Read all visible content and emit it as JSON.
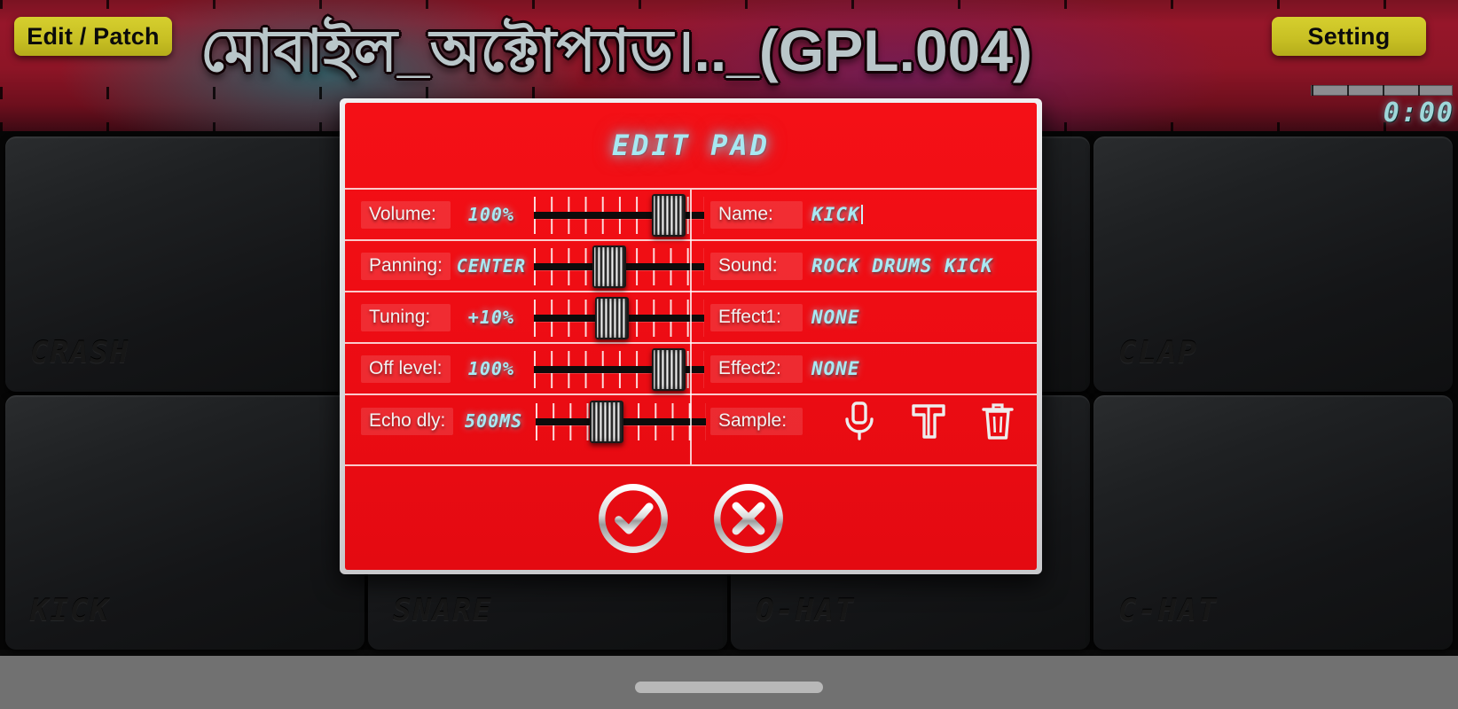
{
  "header": {
    "edit_patch_label": "Edit / Patch",
    "setting_label": "Setting",
    "title": "মোবাইল_অক্টোপ্যাড।.._(GPL.004)",
    "timecode": "0:00"
  },
  "pads": [
    {
      "label": "CRASH"
    },
    {
      "label": ""
    },
    {
      "label": ""
    },
    {
      "label": "CLAP"
    },
    {
      "label": "KICK"
    },
    {
      "label": "SNARE"
    },
    {
      "label": "O-HAT"
    },
    {
      "label": "C-HAT"
    }
  ],
  "dialog": {
    "title": "EDIT PAD",
    "left_rows": [
      {
        "label": "Volume:",
        "value": "100%",
        "thumb_pct": 86
      },
      {
        "label": "Panning:",
        "value": "CENTER",
        "thumb_pct": 48
      },
      {
        "label": "Tuning:",
        "value": "+10%",
        "thumb_pct": 50
      },
      {
        "label": "Off level:",
        "value": "100%",
        "thumb_pct": 86
      },
      {
        "label": "Echo dly:",
        "value": "500MS",
        "thumb_pct": 46
      }
    ],
    "right_rows": [
      {
        "label": "Name:",
        "value": "KICK",
        "editing": true
      },
      {
        "label": "Sound:",
        "value": "ROCK DRUMS KICK",
        "editing": false
      },
      {
        "label": "Effect1:",
        "value": "NONE",
        "editing": false
      },
      {
        "label": "Effect2:",
        "value": "NONE",
        "editing": false
      },
      {
        "label": "Sample:",
        "value": "",
        "editing": false
      }
    ],
    "sample_icons": [
      {
        "name": "microphone-icon"
      },
      {
        "name": "scissors-trim-icon"
      },
      {
        "name": "trash-icon"
      }
    ],
    "footer": {
      "confirm_label": "OK",
      "cancel_label": "Cancel"
    }
  },
  "colors": {
    "dialog_red": "#ef0d14",
    "value_cyan": "#a9e9f3",
    "button_yellow": "#c8c024",
    "pad_dark": "#1e2022"
  }
}
